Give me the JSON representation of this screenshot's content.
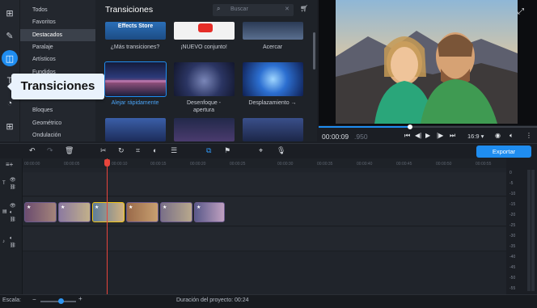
{
  "sidebar": {
    "icons": [
      {
        "name": "import-icon",
        "glyph": "⊞"
      },
      {
        "name": "magic-wand-icon",
        "glyph": "✎"
      },
      {
        "name": "transitions-icon",
        "glyph": "◫"
      },
      {
        "name": "titles-icon",
        "glyph": "T"
      },
      {
        "name": "stickers-icon",
        "glyph": "◔"
      },
      {
        "name": "more-tools-icon",
        "glyph": "⊞"
      }
    ],
    "categories": [
      "Todos",
      "Favoritos",
      "Destacados",
      "Paralaje",
      "Artísticos",
      "Fundidos",
      "",
      "",
      "",
      "Bloques",
      "Geométrico",
      "Ondulación"
    ]
  },
  "tooltip": {
    "text": "Transiciones"
  },
  "panel": {
    "title": "Transiciones",
    "search_placeholder": "Buscar",
    "top_row": [
      {
        "label": "¿Más transiciones?",
        "art": "Effects Store"
      },
      {
        "label": "¡NUEVO conjunto!"
      },
      {
        "label": "Acercar"
      }
    ],
    "mid_row": [
      {
        "label": "Alejar rápidamente",
        "selected": true
      },
      {
        "label": "Desenfoque -\napertura"
      },
      {
        "label": "Desplazamiento →"
      }
    ]
  },
  "player": {
    "timecode": "00:00:09",
    "timecode_ms": ".950",
    "aspect": "16:9 ▾",
    "progress": 0.42
  },
  "toolbar": {
    "export_label": "Exportar"
  },
  "timeline": {
    "ruler": [
      "00:00:00",
      "00:00:05",
      "00:00:10",
      "00:00:15",
      "00:00:20",
      "00:00:25",
      "00:00:30",
      "00:00:35",
      "00:00:40",
      "00:00:45",
      "00:00:50",
      "00:00:55"
    ]
  },
  "meters": {
    "labels": [
      "0",
      "-5",
      "-10",
      "-15",
      "-20",
      "-25",
      "-30",
      "-35",
      "-40",
      "-45",
      "-50",
      "-55"
    ]
  },
  "status": {
    "scale_label": "Escala:",
    "duration_label": "Duración del proyecto:",
    "duration_value": "00:24"
  },
  "colors": {
    "accent": "#1f8df0",
    "playhead": "#e8453c",
    "selected_clip": "#f0c419"
  }
}
